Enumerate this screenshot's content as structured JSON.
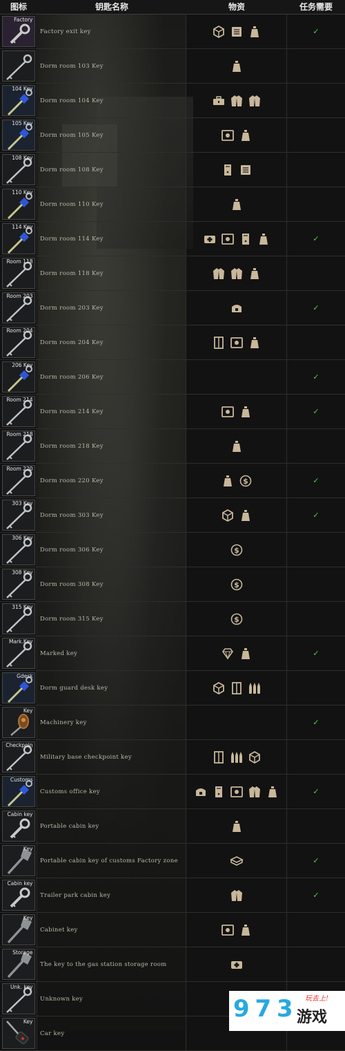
{
  "header": {
    "icon": "图标",
    "name": "钥匙名称",
    "loot": "物资",
    "quest": "任务需要"
  },
  "check_mark": "✓",
  "colors": {
    "loot_icon": "#c8b79a",
    "check": "#4bd34b",
    "row_border": "#2e2e2c",
    "text": "#b9b9a8"
  },
  "rows": [
    {
      "tag": "Factory",
      "name": "Factory exit key",
      "loot": [
        "crate-icon",
        "files-icon",
        "bag-icon"
      ],
      "quest": true,
      "key": "silver-key",
      "box": "purple"
    },
    {
      "tag": "",
      "name": "Dorm room 103 Key",
      "loot": [
        "bag-icon"
      ],
      "quest": false,
      "key": "silver-long-key",
      "box": "dark"
    },
    {
      "tag": "104 Key",
      "name": "Dorm room 104 Key",
      "loot": [
        "toolbox-icon",
        "jacket-icon",
        "jacket-icon"
      ],
      "quest": false,
      "key": "blue-key",
      "box": "blue"
    },
    {
      "tag": "105 Key",
      "name": "Dorm room 105 Key",
      "loot": [
        "safe-icon",
        "bag-icon"
      ],
      "quest": false,
      "key": "blue-key",
      "box": "blue"
    },
    {
      "tag": "108 Key",
      "name": "Dorm room 108 Key",
      "loot": [
        "pc-icon",
        "files-icon"
      ],
      "quest": false,
      "key": "silver-long-key",
      "box": "dark"
    },
    {
      "tag": "110 Key",
      "name": "Dorm room 110 Key",
      "loot": [
        "bag-icon"
      ],
      "quest": false,
      "key": "blue-key",
      "box": "dark"
    },
    {
      "tag": "114 Key",
      "name": "Dorm room 114 Key",
      "loot": [
        "medbag-icon",
        "safe-icon",
        "pc-icon",
        "bag-icon"
      ],
      "quest": true,
      "key": "blue-key",
      "box": "dark"
    },
    {
      "tag": "Room 118",
      "name": "Dorm room 118 Key",
      "loot": [
        "jacket-icon",
        "jacket-icon",
        "bag-icon"
      ],
      "quest": false,
      "key": "silver-long-key",
      "box": "dark"
    },
    {
      "tag": "Room 203",
      "name": "Dorm room 203 Key",
      "loot": [
        "sportbag-icon"
      ],
      "quest": true,
      "key": "silver-long-key",
      "box": "dark"
    },
    {
      "tag": "Room 204",
      "name": "Dorm room 204 Key",
      "loot": [
        "cabinet-icon",
        "safe-icon",
        "bag-icon"
      ],
      "quest": false,
      "key": "silver-long-key",
      "box": "dark"
    },
    {
      "tag": "206 Key",
      "name": "Dorm room 206 Key",
      "loot": [],
      "quest": true,
      "key": "blue-key",
      "box": "dark"
    },
    {
      "tag": "Room 214",
      "name": "Dorm room 214 Key",
      "loot": [
        "safe-icon",
        "bag-icon"
      ],
      "quest": true,
      "key": "silver-long-key",
      "box": "dark"
    },
    {
      "tag": "Room 218",
      "name": "Dorm room 218 Key",
      "loot": [
        "bag-icon"
      ],
      "quest": false,
      "key": "silver-long-key",
      "box": "dark"
    },
    {
      "tag": "Room 220",
      "name": "Dorm room 220 Key",
      "loot": [
        "bag-icon",
        "coin-icon"
      ],
      "quest": true,
      "key": "silver-long-key",
      "box": "dark"
    },
    {
      "tag": "303 Key",
      "name": "Dorm room 303 Key",
      "loot": [
        "crate-icon",
        "bag-icon"
      ],
      "quest": true,
      "key": "silver-long-key",
      "box": "dark"
    },
    {
      "tag": "306 Key",
      "name": "Dorm room 306 Key",
      "loot": [
        "coin-icon"
      ],
      "quest": false,
      "key": "silver-long-key",
      "box": "dark"
    },
    {
      "tag": "308 Key",
      "name": "Dorm room 308 Key",
      "loot": [
        "coin-icon"
      ],
      "quest": false,
      "key": "silver-long-key",
      "box": "dark"
    },
    {
      "tag": "315 Key",
      "name": "Dorm room 315 Key",
      "loot": [
        "coin-icon"
      ],
      "quest": false,
      "key": "silver-long-key",
      "box": "dark"
    },
    {
      "tag": "Mark.Key",
      "name": "Marked key",
      "loot": [
        "diamond-icon",
        "bag-icon"
      ],
      "quest": true,
      "key": "silver-long-key",
      "box": "dark"
    },
    {
      "tag": "Gdesk",
      "name": "Dorm guard desk key",
      "loot": [
        "crate-icon",
        "cabinet-icon",
        "ammo-icon"
      ],
      "quest": false,
      "key": "blue-key",
      "box": "blue"
    },
    {
      "tag": "Key",
      "name": "Machinery key",
      "loot": [],
      "quest": true,
      "key": "brown-key",
      "box": "dark"
    },
    {
      "tag": "Checkpoin",
      "name": "Military base checkpoint key",
      "loot": [
        "cabinet-icon",
        "ammo-icon",
        "crate-icon"
      ],
      "quest": false,
      "key": "silver-long-key",
      "box": "dark"
    },
    {
      "tag": "Customs",
      "name": "Customs office key",
      "loot": [
        "sportbag-icon",
        "pc-icon",
        "safe-icon",
        "jacket-icon",
        "bag-icon"
      ],
      "quest": true,
      "key": "blue-key",
      "box": "blue"
    },
    {
      "tag": "Cabin key",
      "name": "Portable cabin key",
      "loot": [
        "bag-icon"
      ],
      "quest": false,
      "key": "silver-key",
      "box": "dark"
    },
    {
      "tag": "Key",
      "name": "Portable cabin key of customs Factory zone",
      "loot": [
        "box-icon"
      ],
      "quest": true,
      "key": "gray-key",
      "box": "dark"
    },
    {
      "tag": "Cabin key",
      "name": "Trailer park cabin key",
      "loot": [
        "jacket-icon"
      ],
      "quest": true,
      "key": "silver-key",
      "box": "dark"
    },
    {
      "tag": "Key",
      "name": "Cabinet key",
      "loot": [
        "safe-icon",
        "bag-icon"
      ],
      "quest": false,
      "key": "gray-key",
      "box": "dark"
    },
    {
      "tag": "Storage",
      "name": "The key to the gas station storage room",
      "loot": [
        "medbag-icon"
      ],
      "quest": false,
      "key": "gray-key",
      "box": "dark"
    },
    {
      "tag": "Unk. key",
      "name": "Unknown key",
      "loot": [],
      "quest": true,
      "key": "silver-long-key",
      "box": "dark"
    },
    {
      "tag": "Key",
      "name": "Car key",
      "loot": [],
      "quest": false,
      "key": "car-key",
      "box": "dark"
    }
  ],
  "watermark": {
    "number": "9 7 3",
    "brand": "游戏",
    "slogan": "玩去上!"
  }
}
